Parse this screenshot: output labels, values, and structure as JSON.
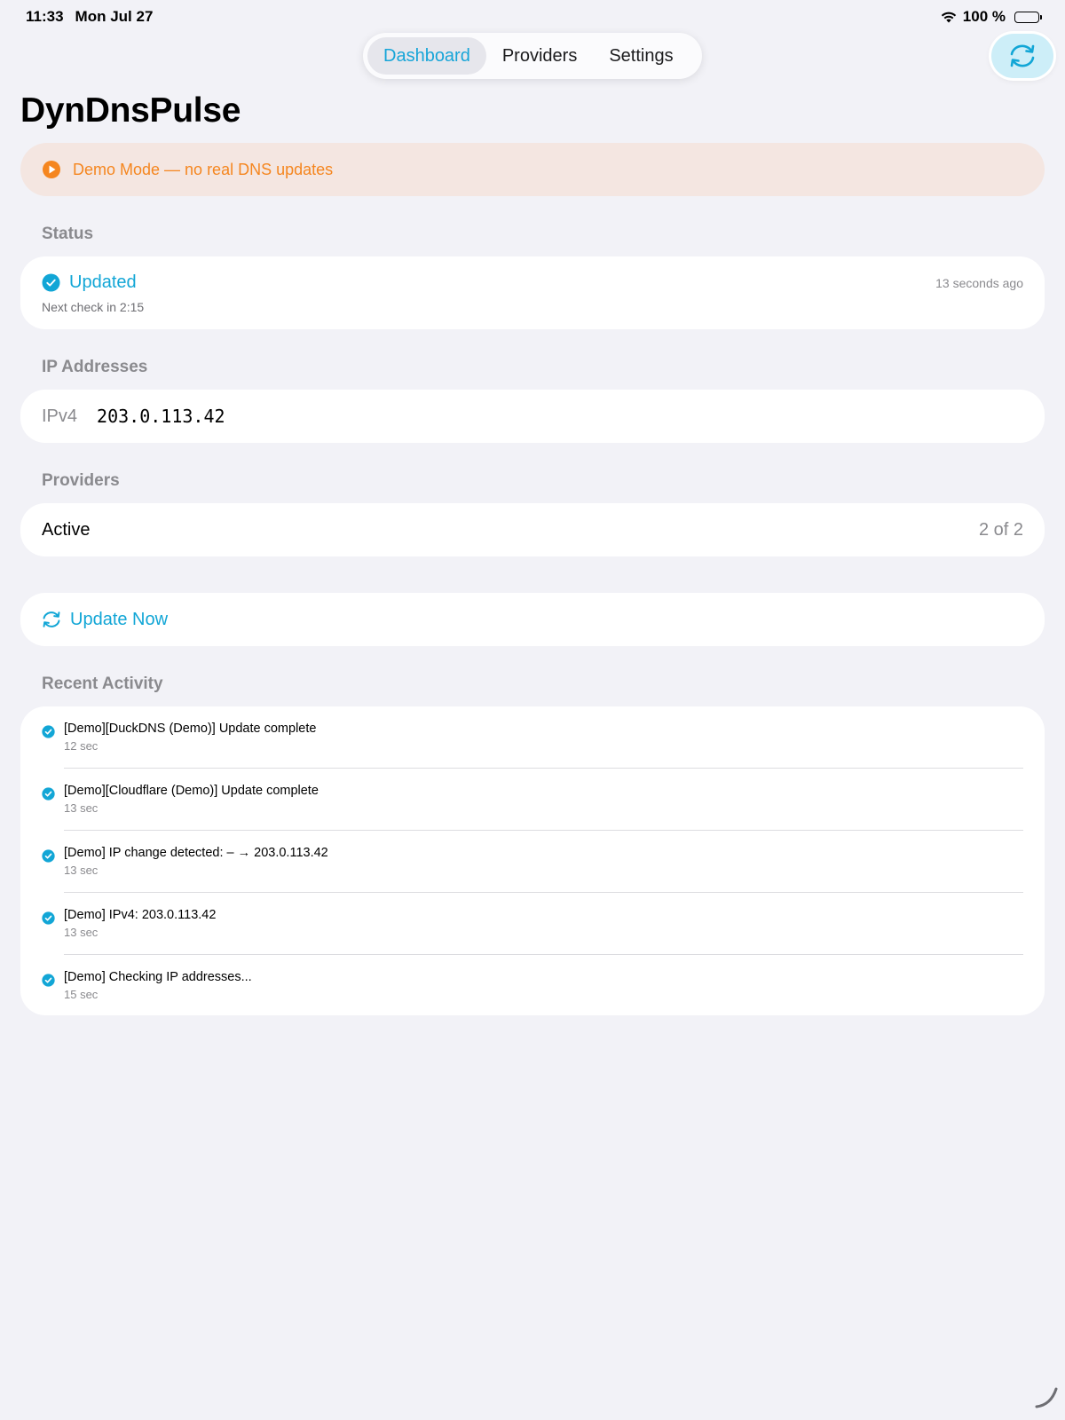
{
  "status_bar": {
    "time": "11:33",
    "date": "Mon Jul 27",
    "battery": "100 %"
  },
  "tabs": [
    {
      "label": "Dashboard",
      "active": true
    },
    {
      "label": "Providers",
      "active": false
    },
    {
      "label": "Settings",
      "active": false
    }
  ],
  "page_title": "DynDnsPulse",
  "banner": {
    "text": "Demo Mode — no real DNS updates",
    "icon": "play-circle-icon",
    "color": "#f5861f"
  },
  "status": {
    "header": "Status",
    "state": "Updated",
    "time_ago": "13 seconds ago",
    "next_check": "Next check in 2:15",
    "icon": "checkmark-circle-icon"
  },
  "ip": {
    "header": "IP Addresses",
    "label": "IPv4",
    "value": "203.0.113.42"
  },
  "providers": {
    "header": "Providers",
    "label": "Active",
    "value": "2 of 2"
  },
  "update_now": {
    "label": "Update Now",
    "icon": "refresh-icon"
  },
  "activity": {
    "header": "Recent Activity",
    "items": [
      {
        "message": "[Demo][DuckDNS (Demo)] Update complete",
        "ago": "12 sec"
      },
      {
        "message": "[Demo][Cloudflare (Demo)] Update complete",
        "ago": "13 sec"
      },
      {
        "message": "[Demo] IP change detected: – → 203.0.113.42",
        "ago": "13 sec"
      },
      {
        "message": "[Demo] IPv4: 203.0.113.42",
        "ago": "13 sec"
      },
      {
        "message": "[Demo] Checking IP addresses...",
        "ago": "15 sec"
      }
    ]
  },
  "colors": {
    "accent": "#12a6d6",
    "background": "#f2f2f7",
    "warning": "#f5861f"
  }
}
